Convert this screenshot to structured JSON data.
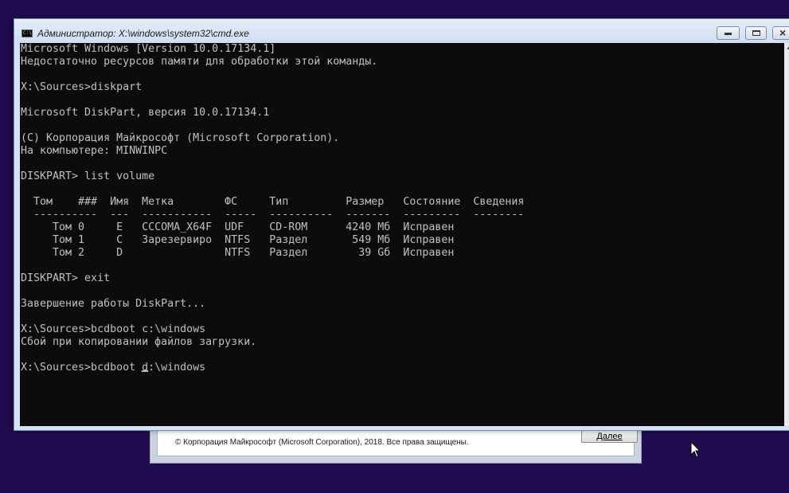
{
  "window": {
    "title": "Администратор: X:\\windows\\system32\\cmd.exe",
    "icon": "cmd-icon",
    "icon_glyph": "C:\\"
  },
  "console": {
    "lines": [
      "Microsoft Windows [Version 10.0.17134.1]",
      "Недостаточно ресурсов памяти для обработки этой команды.",
      "",
      "X:\\Sources>diskpart",
      "",
      "Microsoft DiskPart, версия 10.0.17134.1",
      "",
      "(C) Корпорация Майкрософт (Microsoft Corporation).",
      "На компьютере: MINWINPC",
      "",
      "DISKPART> list volume",
      "",
      "  Том    ###  Имя  Метка        ФС     Тип         Размер   Состояние  Сведения",
      "  ----------  ---  -----------  -----  ----------  -------  ---------  --------",
      "     Том 0     E   CCCOMA_X64F  UDF    CD-ROM      4240 Мб  Исправен",
      "     Том 1     C   Зарезервиро  NTFS   Раздел       549 Мб  Исправен",
      "     Том 2     D                NTFS   Раздел        39 Gб  Исправен",
      "",
      "DISKPART> exit",
      "",
      "Завершение работы DiskPart...",
      "",
      "X:\\Sources>bcdboot c:\\windows",
      "Сбой при копировании файлов загрузки.",
      ""
    ],
    "prompt_line_before_caret": "X:\\Sources>bcdboot d",
    "prompt_line_after_caret": ":\\windows",
    "text_color": "#c0c0c0",
    "background_color": "#0c0c0c"
  },
  "setup_dialog": {
    "copyright": "© Корпорация Майкрософт (Microsoft Corporation), 2018. Все права защищены.",
    "next_button_label": "Далее"
  },
  "colors": {
    "desktop": "#1f0b4e",
    "titlebar": "#d4e3f4"
  }
}
